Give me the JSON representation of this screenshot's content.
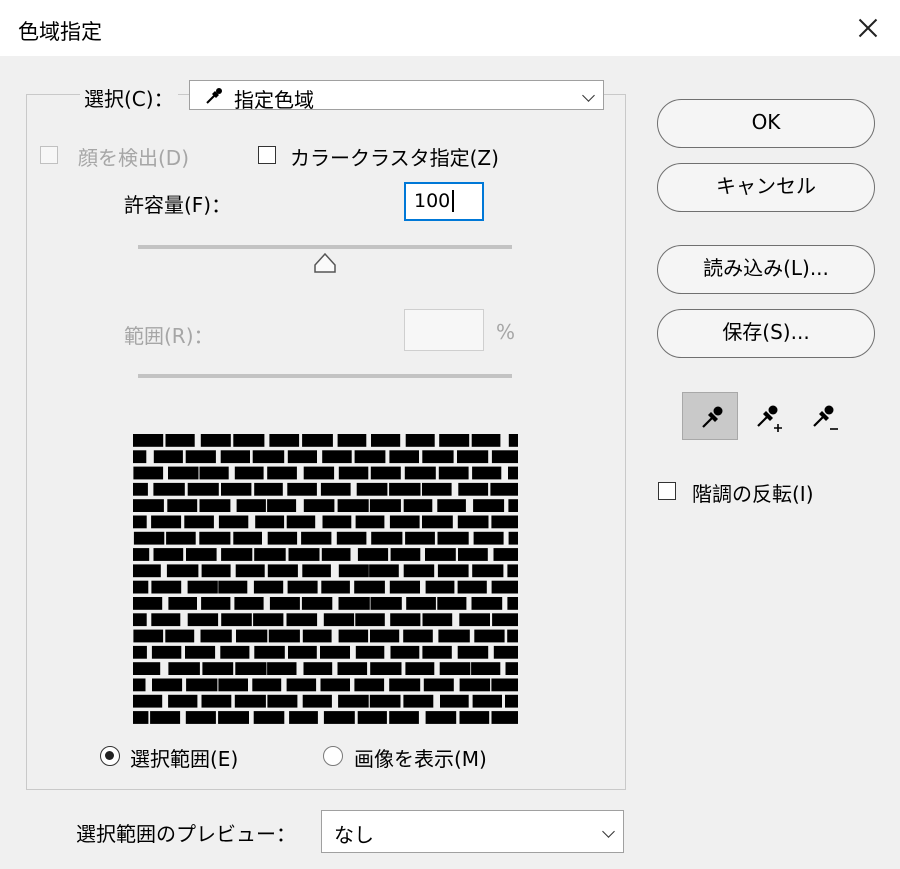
{
  "window": {
    "title": "色域指定"
  },
  "select_row": {
    "label": "選択(C)：",
    "value": "指定色域"
  },
  "options": {
    "detect_faces": "顔を検出(D)",
    "localized_clusters": "カラークラスタ指定(Z)"
  },
  "fuzziness": {
    "label": "許容量(F)：",
    "value": "100",
    "slider_fraction": 0.5
  },
  "range": {
    "label": "範囲(R)：",
    "value": "",
    "unit": "%"
  },
  "buttons": {
    "ok": "OK",
    "cancel": "キャンセル",
    "load": "読み込み(L)...",
    "save": "保存(S)..."
  },
  "tools": {
    "eyedropper": "eyedropper-icon",
    "add_to_sample": "eyedropper-plus-icon",
    "subtract_from_sample": "eyedropper-minus-icon"
  },
  "invert": {
    "label": "階調の反転(I)",
    "checked": false
  },
  "view_mode": {
    "selection": "選択範囲(E)",
    "image": "画像を表示(M)",
    "selected": "selection"
  },
  "preview_row": {
    "label": "選択範囲のプレビュー：",
    "value": "なし"
  },
  "colors": {
    "accent": "#0078d7",
    "dialog_bg": "#f0f0f0",
    "disabled_text": "#a6a6a6",
    "preview_mask": "#000000"
  }
}
